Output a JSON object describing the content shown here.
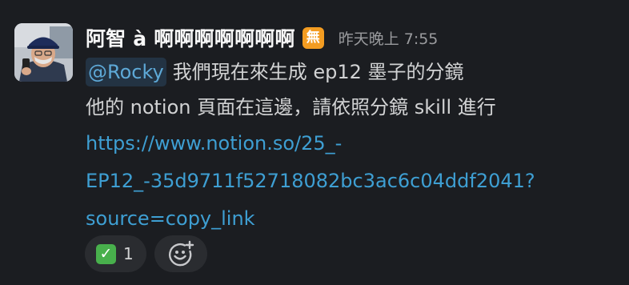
{
  "message": {
    "author": "阿智 à 啊啊啊啊啊啊啊",
    "status_emoji": "無",
    "timestamp": "昨天晚上 7:55",
    "mention": "@Rocky",
    "line1_text": "我們現在來生成 ep12 墨子的分鏡",
    "line2_text": "他的 notion 頁面在這邊，請依照分鏡 skill 進行",
    "link_lines": [
      "https://www.notion.so/25_-",
      "EP12_-35d9711f52718082bc3ac6c04ddf2041?",
      "source=copy_link"
    ]
  },
  "reactions": [
    {
      "emoji": "white-check-mark",
      "count": "1"
    }
  ],
  "add_reaction_icon": "add-reaction-smiley-icon",
  "colors": {
    "background": "#1b1d21",
    "text": "#d1d2d3",
    "link": "#3e9fd3",
    "mention_bg": "#233343",
    "status_emoji_bg": "#f39c21",
    "check_bg": "#48b04c"
  }
}
